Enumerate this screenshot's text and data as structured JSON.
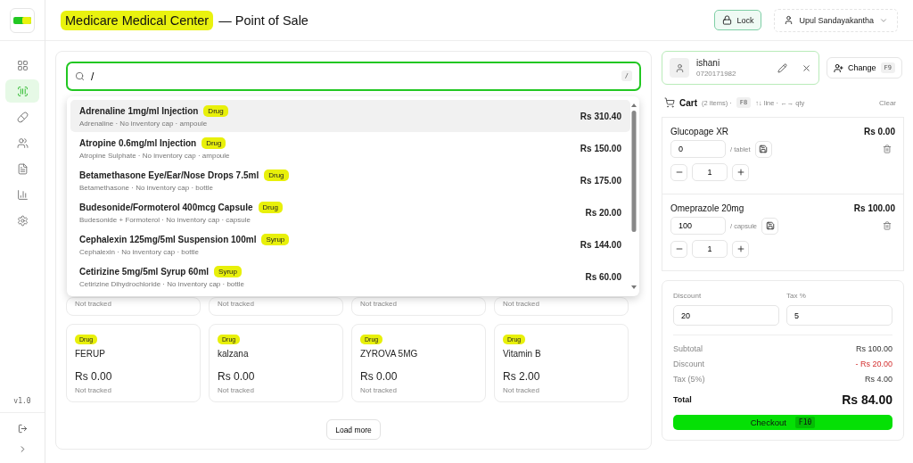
{
  "header": {
    "title": "Medicare Medical Center",
    "subtitle": "— Point of Sale",
    "lock": "Lock",
    "user": "Upul Sandayakantha"
  },
  "sidebar": {
    "items": [
      {
        "kind": "dashboard",
        "selected": false
      },
      {
        "kind": "scan",
        "selected": true
      },
      {
        "kind": "pill",
        "selected": false
      },
      {
        "kind": "users",
        "selected": false
      },
      {
        "kind": "report",
        "selected": false
      },
      {
        "kind": "chart",
        "selected": false
      },
      {
        "kind": "settings",
        "selected": false
      }
    ],
    "version": "v1.0"
  },
  "search": {
    "value": "/",
    "shortcut": "/"
  },
  "results": [
    {
      "name": "Adrenaline 1mg/ml Injection",
      "category": "Drug",
      "detail": "Adrenaline · No inventory cap · ampoule",
      "price": "Rs 310.40",
      "selected": true
    },
    {
      "name": "Atropine 0.6mg/ml Injection",
      "category": "Drug",
      "detail": "Atropine Sulphate · No inventory cap · ampoule",
      "price": "Rs 150.00",
      "selected": false
    },
    {
      "name": "Betamethasone Eye/Ear/Nose Drops 7.5ml",
      "category": "Drug",
      "detail": "Betamethasone · No inventory cap · bottle",
      "price": "Rs 175.00",
      "selected": false
    },
    {
      "name": "Budesonide/Formoterol 400mcg Capsule",
      "category": "Drug",
      "detail": "Budesonide + Formoterol · No inventory cap · capsule",
      "price": "Rs 20.00",
      "selected": false
    },
    {
      "name": "Cephalexin 125mg/5ml Suspension 100ml",
      "category": "Syrup",
      "detail": "Cephalexin · No inventory cap · bottle",
      "price": "Rs 144.00",
      "selected": false
    },
    {
      "name": "Cetirizine 5mg/5ml Syrup 60ml",
      "category": "Syrup",
      "detail": "Cetirizine Dihydrochloride · No inventory cap · bottle",
      "price": "Rs 60.00",
      "selected": false
    }
  ],
  "products": [
    {
      "stock": "Not tracked"
    },
    {
      "stock": "Not tracked"
    },
    {
      "stock": "Not tracked"
    },
    {
      "stock": "Not tracked"
    },
    {
      "category": "Drug",
      "name": "FERUP",
      "price": "Rs 0.00",
      "stock": "Not tracked"
    },
    {
      "category": "Drug",
      "name": "kalzana",
      "price": "Rs 0.00",
      "stock": "Not tracked"
    },
    {
      "category": "Drug",
      "name": "ZYROVA 5MG",
      "price": "Rs 0.00",
      "stock": "Not tracked"
    },
    {
      "category": "Drug",
      "name": "Vitamin B",
      "price": "Rs 2.00",
      "stock": "Not tracked"
    }
  ],
  "load_more": "Load more",
  "customer": {
    "name": "ishani",
    "phone": "0720171982"
  },
  "change": {
    "label": "Change",
    "key": "F9"
  },
  "cart": {
    "title": "Cart",
    "count": "(2 items) ·",
    "key": "F8",
    "hint": "↑↓ line · ←→ qty",
    "clear": "Clear",
    "items": [
      {
        "name": "Glucopage XR",
        "price": "Rs 0.00",
        "unit_price": "0",
        "unit": "/ tablet",
        "qty": "1"
      },
      {
        "name": "Omeprazole 20mg",
        "price": "Rs 100.00",
        "unit_price": "100",
        "unit": "/ capsule",
        "qty": "1"
      }
    ]
  },
  "totals": {
    "discount_label": "Discount",
    "discount": "20",
    "tax_label": "Tax %",
    "tax": "5",
    "lines": [
      {
        "label": "Subtotal",
        "value": "Rs 100.00",
        "kind": "normal"
      },
      {
        "label": "Discount",
        "value": "- Rs 20.00",
        "kind": "negative"
      },
      {
        "label": "Tax (5%)",
        "value": "Rs 4.00",
        "kind": "normal"
      }
    ],
    "total_label": "Total",
    "total": "Rs 84.00",
    "checkout": "Checkout",
    "checkout_key": "F10"
  }
}
